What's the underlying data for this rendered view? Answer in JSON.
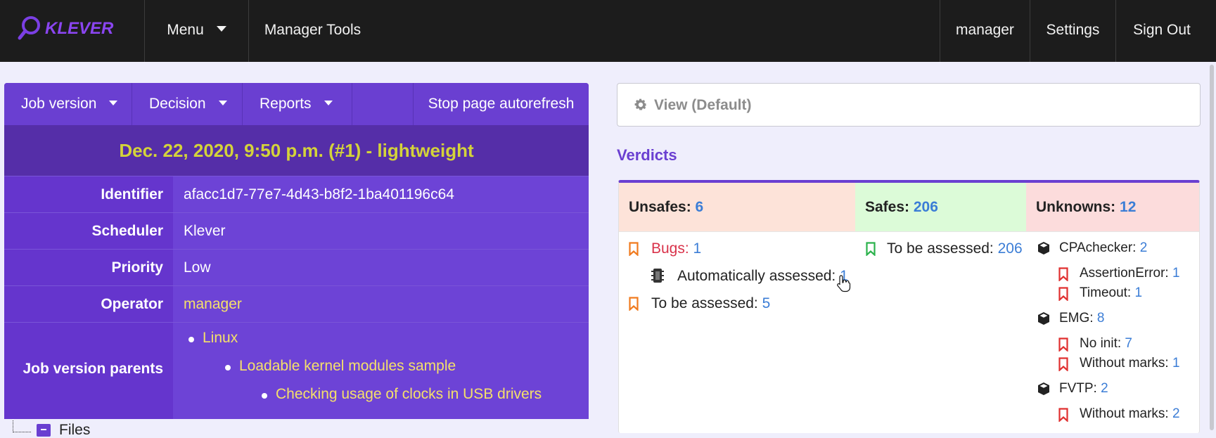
{
  "nav": {
    "menu_label": "Menu",
    "manager_tools_label": "Manager Tools",
    "user_label": "manager",
    "settings_label": "Settings",
    "sign_out_label": "Sign Out",
    "logo_text": "KLEVER"
  },
  "job_menu": {
    "job_version_label": "Job version",
    "decision_label": "Decision",
    "reports_label": "Reports",
    "stop_autorefresh_label": "Stop page autorefresh"
  },
  "job": {
    "title": "Dec. 22, 2020, 9:50 p.m. (#1) - lightweight",
    "rows": {
      "identifier_label": "Identifier",
      "identifier_value": "afacc1d7-77e7-4d43-b8f2-1ba401196c64",
      "scheduler_label": "Scheduler",
      "scheduler_value": "Klever",
      "priority_label": "Priority",
      "priority_value": "Low",
      "operator_label": "Operator",
      "operator_value": "manager",
      "parents_label": "Job version parents"
    },
    "parents": [
      "Linux",
      "Loadable kernel modules sample",
      "Checking usage of clocks in USB drivers"
    ]
  },
  "files": {
    "label": "Files"
  },
  "view": {
    "label": "View (Default)"
  },
  "verdicts": {
    "title": "Verdicts",
    "unsafes": {
      "label": "Unsafes:",
      "count": "6"
    },
    "safes": {
      "label": "Safes:",
      "count": "206"
    },
    "unknowns": {
      "label": "Unknowns:",
      "count": "12"
    },
    "unsafe_items": {
      "bugs_label": "Bugs:",
      "bugs_count": "1",
      "auto_label": "Automatically assessed:",
      "auto_count": "1",
      "tba_label": "To be assessed:",
      "tba_count": "5"
    },
    "safe_items": {
      "tba_label": "To be assessed:",
      "tba_count": "206"
    },
    "unknown_items": {
      "cpa_label": "CPAchecker:",
      "cpa_count": "2",
      "assertion_label": "AssertionError:",
      "assertion_count": "1",
      "timeout_label": "Timeout:",
      "timeout_count": "1",
      "emg_label": "EMG:",
      "emg_count": "8",
      "noinit_label": "No init:",
      "noinit_count": "7",
      "womarks1_label": "Without marks:",
      "womarks1_count": "1",
      "fvtp_label": "FVTP:",
      "fvtp_count": "2",
      "womarks2_label": "Without marks:",
      "womarks2_count": "2"
    }
  },
  "colors": {
    "accent": "#6a3fd1",
    "unsafes_bg": "#fde3d9",
    "safes_bg": "#dcfbd8",
    "unknowns_bg": "#fcdcdc",
    "link_yellow": "#f5e06a",
    "count_blue": "#3b7dd6"
  }
}
